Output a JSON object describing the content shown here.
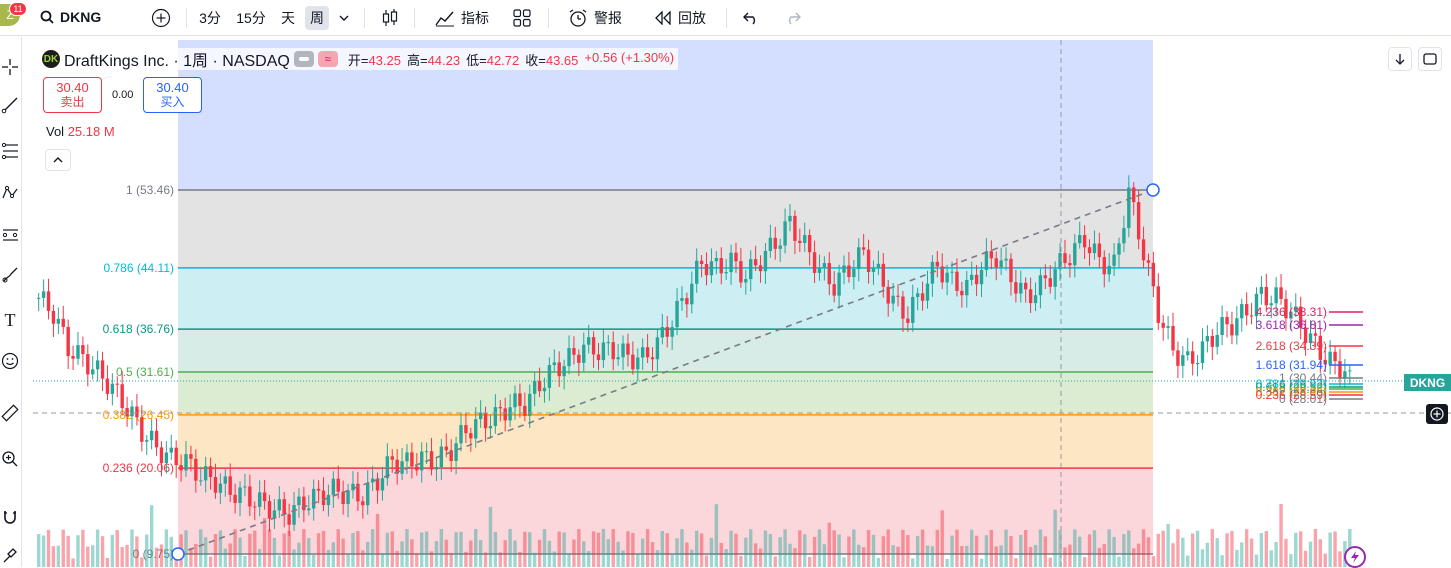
{
  "topbar": {
    "avatar_letter": "Z",
    "notifications": "11",
    "symbol": "DKNG",
    "intervals": [
      "3分",
      "15分",
      "天",
      "周"
    ],
    "active_interval": "周",
    "indicators_label": "指标",
    "alert_label": "警报",
    "replay_label": "回放"
  },
  "legend": {
    "title": "DraftKings Inc. · 1周 · NASDAQ",
    "open_label": "开=",
    "open": "43.25",
    "high_label": "高=",
    "high": "44.23",
    "low_label": "低=",
    "low": "42.72",
    "close_label": "收=",
    "close": "43.65",
    "change": "+0.56 (+1.30%)"
  },
  "trade": {
    "sell_price": "30.40",
    "sell_label": "卖出",
    "spread": "0.00",
    "buy_price": "30.40",
    "buy_label": "买入"
  },
  "volume": {
    "label": "Vol",
    "value": "25.18 M"
  },
  "price_tag": "DKNG",
  "fib_retracement": [
    {
      "label": "1 (53.46)",
      "color": "#787b86"
    },
    {
      "label": "0.786 (44.11)",
      "color": "#00bcd4"
    },
    {
      "label": "0.618 (36.76)",
      "color": "#089981"
    },
    {
      "label": "0.5 (31.61)",
      "color": "#4caf50"
    },
    {
      "label": "0.382 (26.45)",
      "color": "#ff9800"
    },
    {
      "label": "0.236 (20.06)",
      "color": "#f23645"
    },
    {
      "label": "0 (9.75)",
      "color": "#787b86"
    }
  ],
  "fib_extension": [
    {
      "label": "4.236 (38.31)",
      "color": "#e91e63"
    },
    {
      "label": "3.618 (36.81)",
      "color": "#9c27b0"
    },
    {
      "label": "2.618 (34.39)",
      "color": "#f23645"
    },
    {
      "label": "1.618 (31.94)",
      "color": "#2962ff"
    },
    {
      "label": "1 (30.44)",
      "color": "#787b86"
    },
    {
      "label": "0.786 (29.92)",
      "color": "#00bcd4"
    },
    {
      "label": "0.618 (29.52)",
      "color": "#089981"
    },
    {
      "label": "0.5 (29.23)",
      "color": "#4caf50"
    },
    {
      "label": "0.382 (28.95)",
      "color": "#ff9800"
    },
    {
      "label": "0.236 (28.59)",
      "color": "#f23645"
    },
    {
      "label": "0 (28.01)",
      "color": "#787b86"
    }
  ],
  "colors": {
    "up": "#26a69a",
    "down": "#f23645",
    "accent": "#2962ff"
  },
  "chart_data": {
    "type": "candlestick",
    "series_closes": [
      40.5,
      38.7,
      34.5,
      33.2,
      31.6,
      29.7,
      27.3,
      24.5,
      22.5,
      21.2,
      20.8,
      19.2,
      18.5,
      17.3,
      16.8,
      15.9,
      15.1,
      14.6,
      15.9,
      16.7,
      17.4,
      17.0,
      16.7,
      18.6,
      20.9,
      20.6,
      21.2,
      20.9,
      22.3,
      24.6,
      25.6,
      26.2,
      27.6,
      27.7,
      30.1,
      32.0,
      33.1,
      34.6,
      34.2,
      34.3,
      33.4,
      33.2,
      35.0,
      37.8,
      41.1,
      44.8,
      44.1,
      44.8,
      43.1,
      45.1,
      47.1,
      49.5,
      46.7,
      44.0,
      42.0,
      44.1,
      45.9,
      43.2,
      40.1,
      38.4,
      41.5,
      44.4,
      42.4,
      41.6,
      44.3,
      45.6,
      43.0,
      40.6,
      41.9,
      43.9,
      45.7,
      47.6,
      44.9,
      44.3,
      53.2,
      46.0,
      38.8,
      34.2,
      32.8,
      34.3,
      36.6,
      37.4,
      38.9,
      40.8,
      40.5,
      38.9,
      36.4,
      34.0,
      32.3,
      31.8
    ]
  }
}
